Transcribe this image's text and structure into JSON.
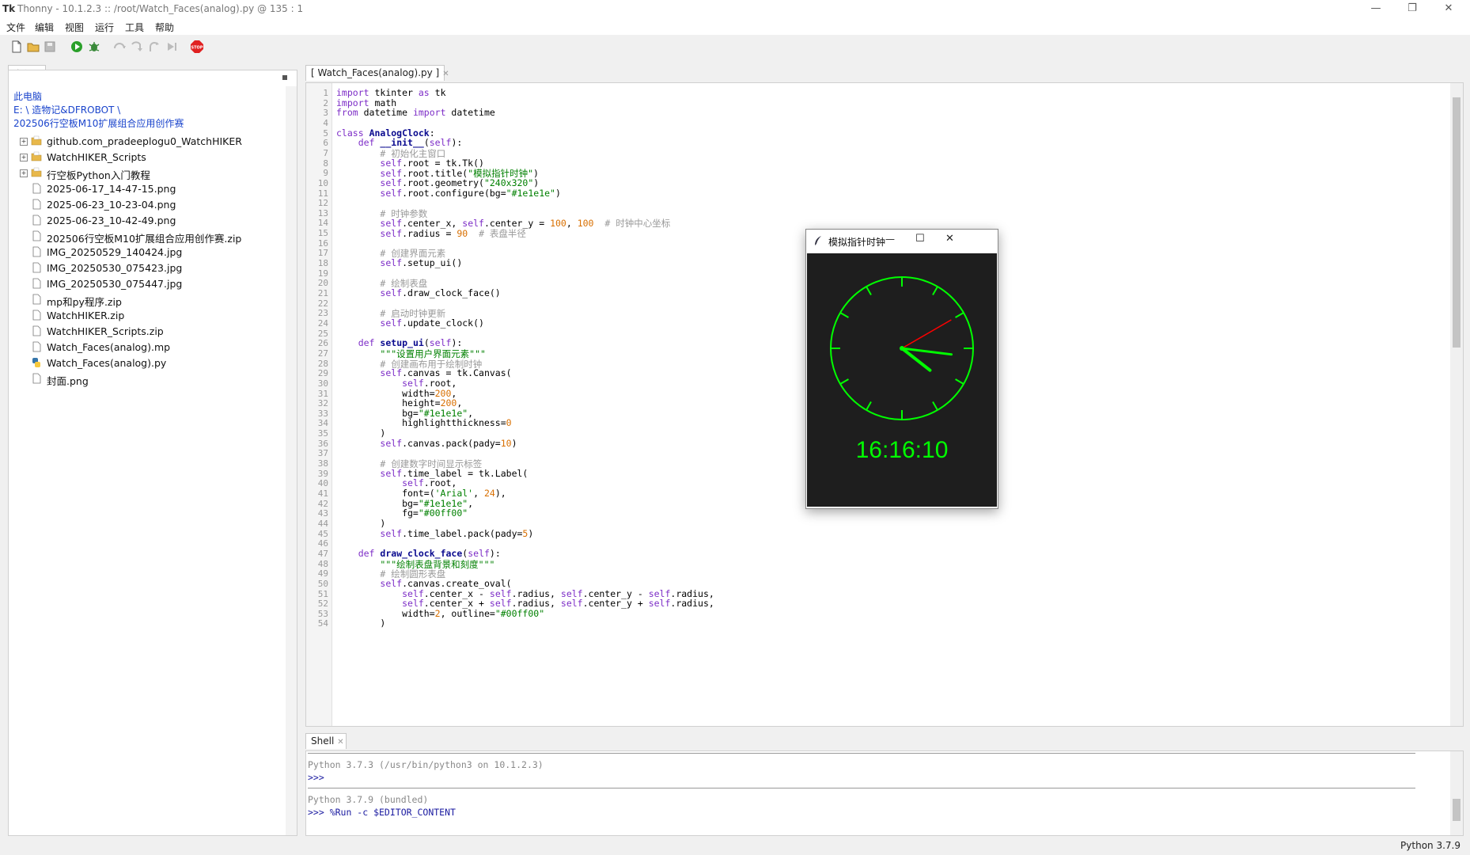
{
  "window": {
    "title": "Thonny  -  10.1.2.3 :: /root/Watch_Faces(analog).py  @  135 : 1",
    "app_icon": "Tk",
    "minimize": "—",
    "restore": "❐",
    "close": "✕"
  },
  "menu": [
    "文件",
    "编辑",
    "视图",
    "运行",
    "工具",
    "帮助"
  ],
  "toolbar": {
    "new": "new-file-icon",
    "open": "open-folder-icon",
    "save": "save-icon",
    "run": "run-icon",
    "debug": "debug-icon",
    "step_over": "step-over-icon",
    "step_into": "step-into-icon",
    "step_out": "step-out-icon",
    "resume": "resume-icon",
    "stop": "STOP",
    "stop_color": "#e02020"
  },
  "files_panel": {
    "tab": "文件",
    "path_lines": [
      "此电脑",
      "E: \\ 造物记&DFROBOT \\",
      "202506行空板M10扩展组合应用创作赛"
    ],
    "items": [
      {
        "name": "github.com_pradeeplogu0_WatchHIKER",
        "type": "folder",
        "expandable": true
      },
      {
        "name": "WatchHIKER_Scripts",
        "type": "folder",
        "expandable": true
      },
      {
        "name": "行空板Python入门教程",
        "type": "folder",
        "expandable": true
      },
      {
        "name": "2025-06-17_14-47-15.png",
        "type": "file"
      },
      {
        "name": "2025-06-23_10-23-04.png",
        "type": "file"
      },
      {
        "name": "2025-06-23_10-42-49.png",
        "type": "file"
      },
      {
        "name": "202506行空板M10扩展组合应用创作赛.zip",
        "type": "file"
      },
      {
        "name": "IMG_20250529_140424.jpg",
        "type": "file"
      },
      {
        "name": "IMG_20250530_075423.jpg",
        "type": "file"
      },
      {
        "name": "IMG_20250530_075447.jpg",
        "type": "file"
      },
      {
        "name": "mp和py程序.zip",
        "type": "file"
      },
      {
        "name": "WatchHIKER.zip",
        "type": "file"
      },
      {
        "name": "WatchHIKER_Scripts.zip",
        "type": "file"
      },
      {
        "name": "Watch_Faces(analog).mp",
        "type": "file"
      },
      {
        "name": "Watch_Faces(analog).py",
        "type": "python"
      },
      {
        "name": "封面.png",
        "type": "file"
      }
    ]
  },
  "editor": {
    "tab": "[ Watch_Faces(analog).py ]",
    "lines": [
      "import tkinter as tk",
      "import math",
      "from datetime import datetime",
      "",
      "class AnalogClock:",
      "    def __init__(self):",
      "        # 初始化主窗口",
      "        self.root = tk.Tk()",
      "        self.root.title(\"模拟指针时钟\")",
      "        self.root.geometry(\"240x320\")",
      "        self.root.configure(bg=\"#1e1e1e\")",
      "",
      "        # 时钟参数",
      "        self.center_x, self.center_y = 100, 100  # 时钟中心坐标",
      "        self.radius = 90  # 表盘半径",
      "",
      "        # 创建界面元素",
      "        self.setup_ui()",
      "",
      "        # 绘制表盘",
      "        self.draw_clock_face()",
      "",
      "        # 启动时钟更新",
      "        self.update_clock()",
      "",
      "    def setup_ui(self):",
      "        \"\"\"设置用户界面元素\"\"\"",
      "        # 创建画布用于绘制时钟",
      "        self.canvas = tk.Canvas(",
      "            self.root,",
      "            width=200,",
      "            height=200,",
      "            bg=\"#1e1e1e\",",
      "            highlightthickness=0",
      "        )",
      "        self.canvas.pack(pady=10)",
      "",
      "        # 创建数字时间显示标签",
      "        self.time_label = tk.Label(",
      "            self.root,",
      "            font=('Arial', 24),",
      "            bg=\"#1e1e1e\",",
      "            fg=\"#00ff00\"",
      "        )",
      "        self.time_label.pack(pady=5)",
      "",
      "    def draw_clock_face(self):",
      "        \"\"\"绘制表盘背景和刻度\"\"\"",
      "        # 绘制圆形表盘",
      "        self.canvas.create_oval(",
      "            self.center_x - self.radius, self.center_y - self.radius,",
      "            self.center_x + self.radius, self.center_y + self.radius,",
      "            width=2, outline=\"#00ff00\"",
      "        )"
    ]
  },
  "shell": {
    "tab": "Shell",
    "lines": [
      {
        "text": "Python 3.7.3 (/usr/bin/python3 on 10.1.2.3)",
        "kind": "info"
      },
      {
        "text": ">>>",
        "kind": "prompt"
      },
      {
        "text": "",
        "kind": "sep"
      },
      {
        "text": "Python 3.7.9 (bundled)",
        "kind": "info"
      },
      {
        "text": ">>> %Run -c $EDITOR_CONTENT",
        "kind": "prompt"
      }
    ]
  },
  "status": {
    "interpreter": "Python 3.7.9"
  },
  "clock_window": {
    "title": "模拟指针时钟",
    "minimize": "—",
    "maximize": "☐",
    "close": "✕",
    "time": "16:16:10",
    "bg": "#1e1e1e",
    "accent": "#00ff00",
    "second_hand_color": "#ff0000",
    "hours": 16,
    "minutes": 16,
    "seconds": 10
  }
}
